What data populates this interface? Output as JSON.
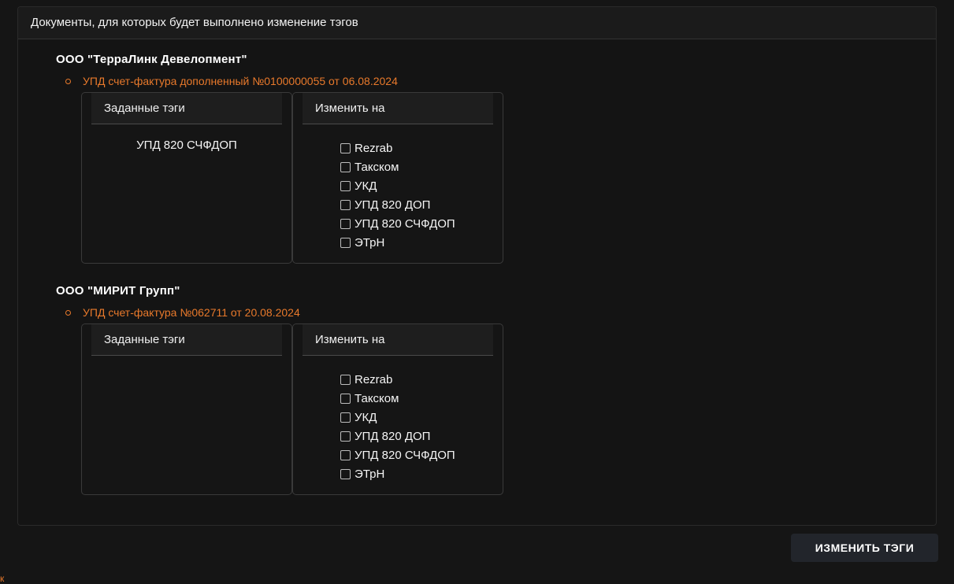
{
  "panel": {
    "title": "Документы, для которых будет выполнено изменение тэгов"
  },
  "documents": [
    {
      "organization": "ООО \"ТерраЛинк Девелопмент\"",
      "document": "УПД счет-фактура дополненный №0100000055 от 06.08.2024",
      "assigned_header": "Заданные тэги",
      "change_header": "Изменить на",
      "assigned_tags": [
        "УПД 820 СЧФДОП"
      ],
      "options": [
        "Rezrab",
        "Такском",
        "УКД",
        "УПД 820 ДОП",
        "УПД 820 СЧФДОП",
        "ЭТрН"
      ]
    },
    {
      "organization": "ООО \"МИРИТ Групп\"",
      "document": "УПД счет-фактура №062711 от 20.08.2024",
      "assigned_header": "Заданные тэги",
      "change_header": "Изменить на",
      "assigned_tags": [],
      "options": [
        "Rezrab",
        "Такском",
        "УКД",
        "УПД 820 ДОП",
        "УПД 820 СЧФДОП",
        "ЭТрН"
      ]
    }
  ],
  "actions": {
    "change_tags_label": "ИЗМЕНИТЬ ТЭГИ"
  },
  "corner_text": "к",
  "colors": {
    "background": "#151515",
    "accent": "#e8792b",
    "button": "#22252b"
  }
}
